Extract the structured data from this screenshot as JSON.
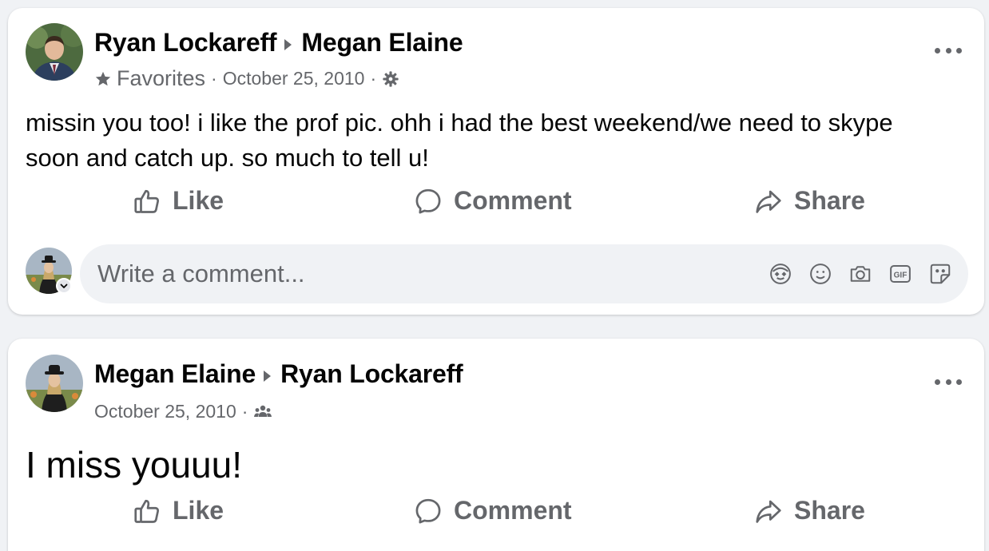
{
  "posts": [
    {
      "author": "Ryan Lockareff",
      "recipient": "Megan Elaine",
      "audience_label": "Favorites",
      "date": "October 25, 2010",
      "privacy_icon": "gear-icon",
      "text": "missin you too! i like the prof pic. ohh i had the best weekend/we need to skype soon and catch up. so much to tell u!",
      "actions": {
        "like": "Like",
        "comment": "Comment",
        "share": "Share"
      },
      "comment_placeholder": "Write a comment..."
    },
    {
      "author": "Megan Elaine",
      "recipient": "Ryan Lockareff",
      "date": "October 25, 2010",
      "privacy_icon": "friends-icon",
      "text": "I miss youuu!",
      "actions": {
        "like": "Like",
        "comment": "Comment",
        "share": "Share"
      }
    }
  ],
  "comment_tools": [
    "avatar-sticker-icon",
    "emoji-icon",
    "camera-icon",
    "gif-icon",
    "sticker-icon"
  ],
  "colors": {
    "background": "#f0f2f5",
    "card": "#ffffff",
    "secondary_text": "#65676b",
    "primary_text": "#050505"
  }
}
